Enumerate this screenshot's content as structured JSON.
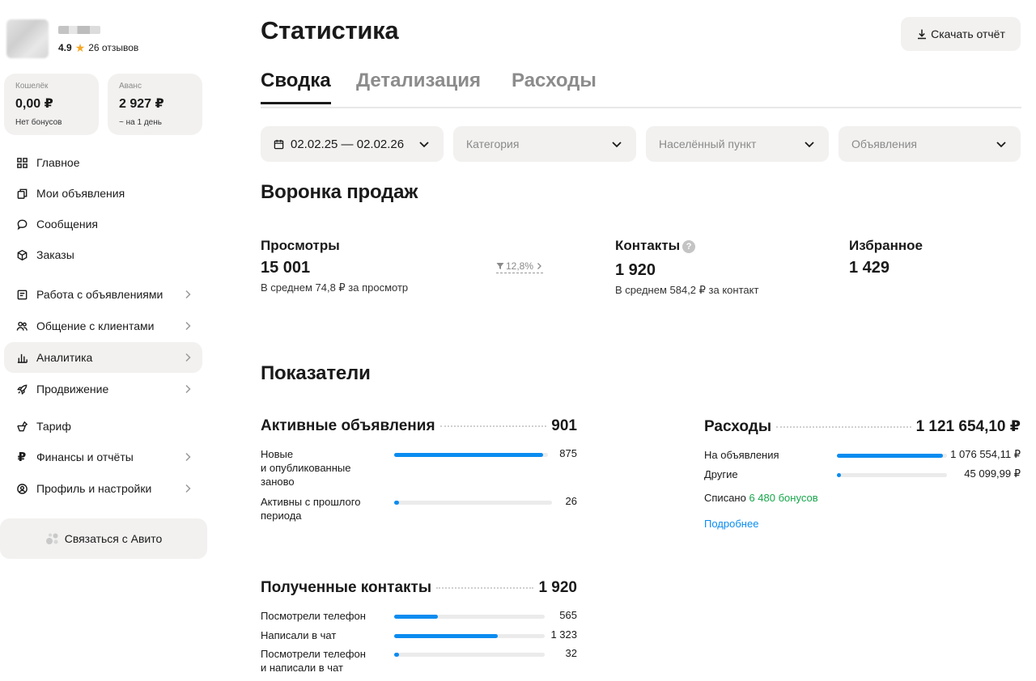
{
  "profile": {
    "rating": "4.9",
    "reviews": "26 отзывов"
  },
  "wallets": [
    {
      "label": "Кошелёк",
      "value": "0,00 ₽",
      "sub": "Нет бонусов"
    },
    {
      "label": "Аванс",
      "value": "2 927 ₽",
      "sub": "~ на 1 день"
    }
  ],
  "nav": [
    {
      "label": "Главное",
      "icon": "grid-icon"
    },
    {
      "label": "Мои объявления",
      "icon": "copy-icon"
    },
    {
      "label": "Сообщения",
      "icon": "chat-bubble-icon"
    },
    {
      "label": "Заказы",
      "icon": "box-icon"
    },
    {
      "label": "Работа с объявлениями",
      "icon": "document-icon"
    },
    {
      "label": "Общение с клиентами",
      "icon": "people-icon"
    },
    {
      "label": "Аналитика",
      "icon": "bar-chart-icon"
    },
    {
      "label": "Продвижение",
      "icon": "rocket-icon"
    },
    {
      "label": "Тариф",
      "icon": "tariff-icon"
    },
    {
      "label": "Финансы и отчёты",
      "icon": "ruble-icon"
    },
    {
      "label": "Профиль и настройки",
      "icon": "profile-icon"
    }
  ],
  "contact_button": "Связаться с Авито",
  "page": {
    "title": "Статистика",
    "download": "Скачать отчёт",
    "tabs": [
      "Сводка",
      "Детализация",
      "Расходы"
    ],
    "active_tab": 0
  },
  "filters": {
    "date": "02.02.25 — 02.02.26",
    "category": "Категория",
    "city": "Населённый пункт",
    "ads": "Объявления"
  },
  "funnel": {
    "title": "Воронка продаж",
    "views": {
      "label": "Просмотры",
      "value": "15 001",
      "sub": "В среднем 74,8 ₽ за просмотр",
      "trend": "12,8%"
    },
    "contacts": {
      "label": "Контакты",
      "value": "1 920",
      "sub": "В среднем 584,2 ₽ за контакт",
      "help": "?"
    },
    "favorites": {
      "label": "Избранное",
      "value": "1 429"
    }
  },
  "indicators": {
    "title": "Показатели",
    "active_ads": {
      "title": "Активные объявления",
      "total": "901",
      "rows": [
        {
          "label_lines": [
            "Новые",
            "и опубликованные",
            "заново"
          ],
          "value": "875",
          "fraction": 0.97
        },
        {
          "label_lines": [
            "Активны с прошлого",
            "периода"
          ],
          "value": "26",
          "fraction": 0.03
        }
      ]
    },
    "expenses": {
      "title": "Расходы",
      "total": "1 121 654,10 ₽",
      "rows": [
        {
          "label": "На объявления",
          "value": "1 076 554,11 ₽",
          "fraction": 0.96
        },
        {
          "label": "Другие",
          "value": "45 099,99 ₽",
          "fraction": 0.04
        }
      ],
      "written_off_prefix": "Списано",
      "written_off_value": "6 480 бонусов",
      "more": "Подробнее"
    },
    "contacts_received": {
      "title": "Полученные контакты",
      "total": "1 920",
      "rows": [
        {
          "label_lines": [
            "Посмотрели телефон"
          ],
          "value": "565",
          "fraction": 0.29
        },
        {
          "label_lines": [
            "Написали в чат"
          ],
          "value": "1 323",
          "fraction": 0.69
        },
        {
          "label_lines": [
            "Посмотрели телефон",
            "и написали в чат"
          ],
          "value": "32",
          "fraction": 0.02
        }
      ]
    }
  }
}
